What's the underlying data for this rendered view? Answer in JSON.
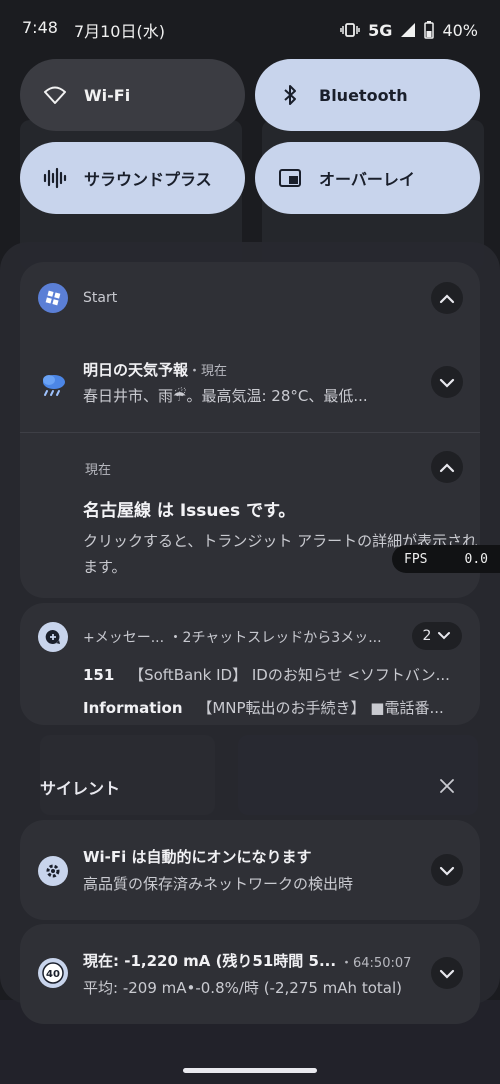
{
  "status_bar": {
    "time": "7:48",
    "date": "7月10日(水)",
    "network": "5G",
    "battery": "40%",
    "icons": [
      "vibrate-icon",
      "signal-icon",
      "battery-icon"
    ]
  },
  "quick_tiles": [
    {
      "label": "Wi-Fi",
      "icon": "wifi-icon",
      "active": false
    },
    {
      "label": "Bluetooth",
      "icon": "bluetooth-icon",
      "active": true
    },
    {
      "label": "サラウンドプラス",
      "icon": "surround-icon",
      "active": true
    },
    {
      "label": "オーバーレイ",
      "icon": "overlay-icon",
      "active": true
    }
  ],
  "notifications": {
    "start": {
      "app_name": "Start",
      "weather_title": "明日の天気予報",
      "weather_time": "・現在",
      "weather_body": "春日井市、雨☔。最高気温: 28°C、最低..."
    },
    "transit": {
      "time": "現在",
      "title": "名古屋線 は Issues です。",
      "body": "クリックすると、トランジット アラートの詳細が表示されます。"
    },
    "messages": {
      "header": "+メッセー... ・2チャットスレッドから3メッ...",
      "count": "2",
      "row1_sender": "151",
      "row1_text": "【SoftBank ID】 IDのお知らせ <ソフトバン...",
      "row2_sender": "Information",
      "row2_text": "【MNP転出のお手続き】 ■電話番..."
    },
    "silent_label": "サイレント",
    "wifi": {
      "title": "Wi-Fi は自動的にオンになります",
      "body": "高品質の保存済みネットワークの検出時"
    },
    "battery": {
      "title": "現在: -1,220 mA (残り51時間 5...",
      "time": "・64:50:07",
      "body": "平均: -209 mA•-0.8%/時 (-2,275 mAh total)",
      "icon_value": "40"
    }
  },
  "fps_overlay": {
    "label": "FPS",
    "value": "0.0"
  },
  "colors": {
    "tile_active": "#c8d4ec",
    "tile_inactive": "#3b3c42",
    "card": "#2f3036",
    "start_icon": "#5b7fd6"
  }
}
